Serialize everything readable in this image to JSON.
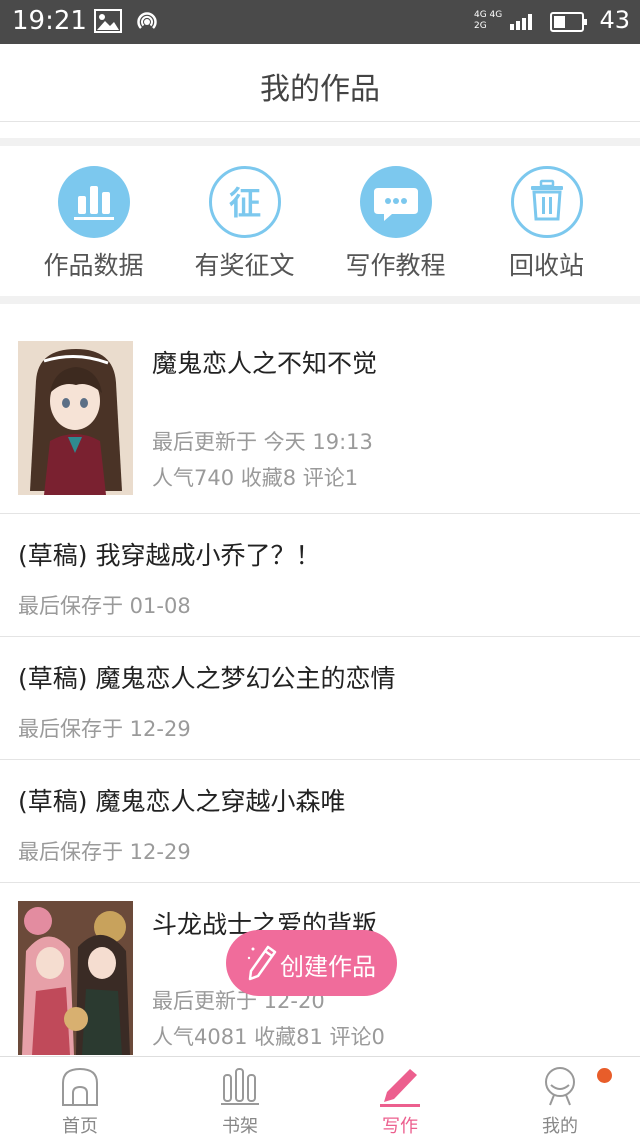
{
  "status_bar": {
    "time": "19:21",
    "network_top": "4G 4G",
    "network_bottom": "2G",
    "battery": "43",
    "battery_level": 0.43
  },
  "header": {
    "title": "我的作品"
  },
  "actions": [
    {
      "label": "作品数据",
      "icon": "bar-chart-icon",
      "color": "#7cc8ee"
    },
    {
      "label": "有奖征文",
      "icon": "zheng-icon",
      "glyph": "征",
      "color": "#7cc8ee"
    },
    {
      "label": "写作教程",
      "icon": "chat-bubble-icon",
      "color": "#7cc8ee"
    },
    {
      "label": "回收站",
      "icon": "trash-icon",
      "color": "#7cc8ee"
    }
  ],
  "works": [
    {
      "title": "魔鬼恋人之不知不觉",
      "updated": "最后更新于 今天 19:13",
      "stats": "人气740 收藏8 评论1",
      "has_cover": true
    },
    {
      "title": "(草稿) 我穿越成小乔了？！",
      "saved": "最后保存于 01-08"
    },
    {
      "title": "(草稿) 魔鬼恋人之梦幻公主的恋情",
      "saved": "最后保存于 12-29"
    },
    {
      "title": "(草稿) 魔鬼恋人之穿越小森唯",
      "saved": "最后保存于 12-29"
    },
    {
      "title": "斗龙战士之爱的背叛",
      "updated": "最后更新于 12-20",
      "stats": "人气4081 收藏81 评论0",
      "has_cover": true
    }
  ],
  "fab": {
    "label": "创建作品",
    "color": "#f06c9b"
  },
  "tabs": [
    {
      "label": "首页",
      "icon": "home-icon",
      "active": false
    },
    {
      "label": "书架",
      "icon": "bookshelf-icon",
      "active": false
    },
    {
      "label": "写作",
      "icon": "pen-icon",
      "active": true
    },
    {
      "label": "我的",
      "icon": "profile-icon",
      "active": false,
      "badge": true
    }
  ],
  "colors": {
    "accent": "#ec5f8e",
    "icon_blue": "#7cc8ee",
    "badge": "#e85d2a"
  }
}
